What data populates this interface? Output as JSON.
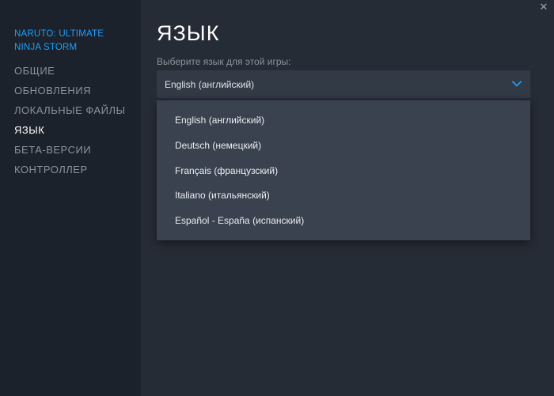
{
  "sidebar": {
    "game_title": "NARUTO: ULTIMATE NINJA STORM",
    "items": [
      {
        "label": "ОБЩИЕ"
      },
      {
        "label": "ОБНОВЛЕНИЯ"
      },
      {
        "label": "ЛОКАЛЬНЫЕ ФАЙЛЫ"
      },
      {
        "label": "ЯЗЫК",
        "active": true
      },
      {
        "label": "БЕТА-ВЕРСИИ"
      },
      {
        "label": "КОНТРОЛЛЕР"
      }
    ]
  },
  "main": {
    "close_glyph": "✕",
    "title": "ЯЗЫК",
    "prompt": "Выберите язык для этой игры:",
    "select": {
      "value": "English (английский)"
    },
    "options": [
      {
        "label": "English (английский)"
      },
      {
        "label": "Deutsch (немецкий)"
      },
      {
        "label": "Français (французский)"
      },
      {
        "label": "Italiano (итальянский)"
      },
      {
        "label": "Español - España (испанский)"
      }
    ]
  },
  "colors": {
    "accent": "#1a9fff",
    "sidebar_bg": "#1c222b",
    "main_bg": "#262c36",
    "select_bg": "#323a46",
    "dropdown_bg": "#3a4250"
  },
  "icons": {
    "close": "close-icon",
    "chevron": "chevron-down-icon"
  }
}
